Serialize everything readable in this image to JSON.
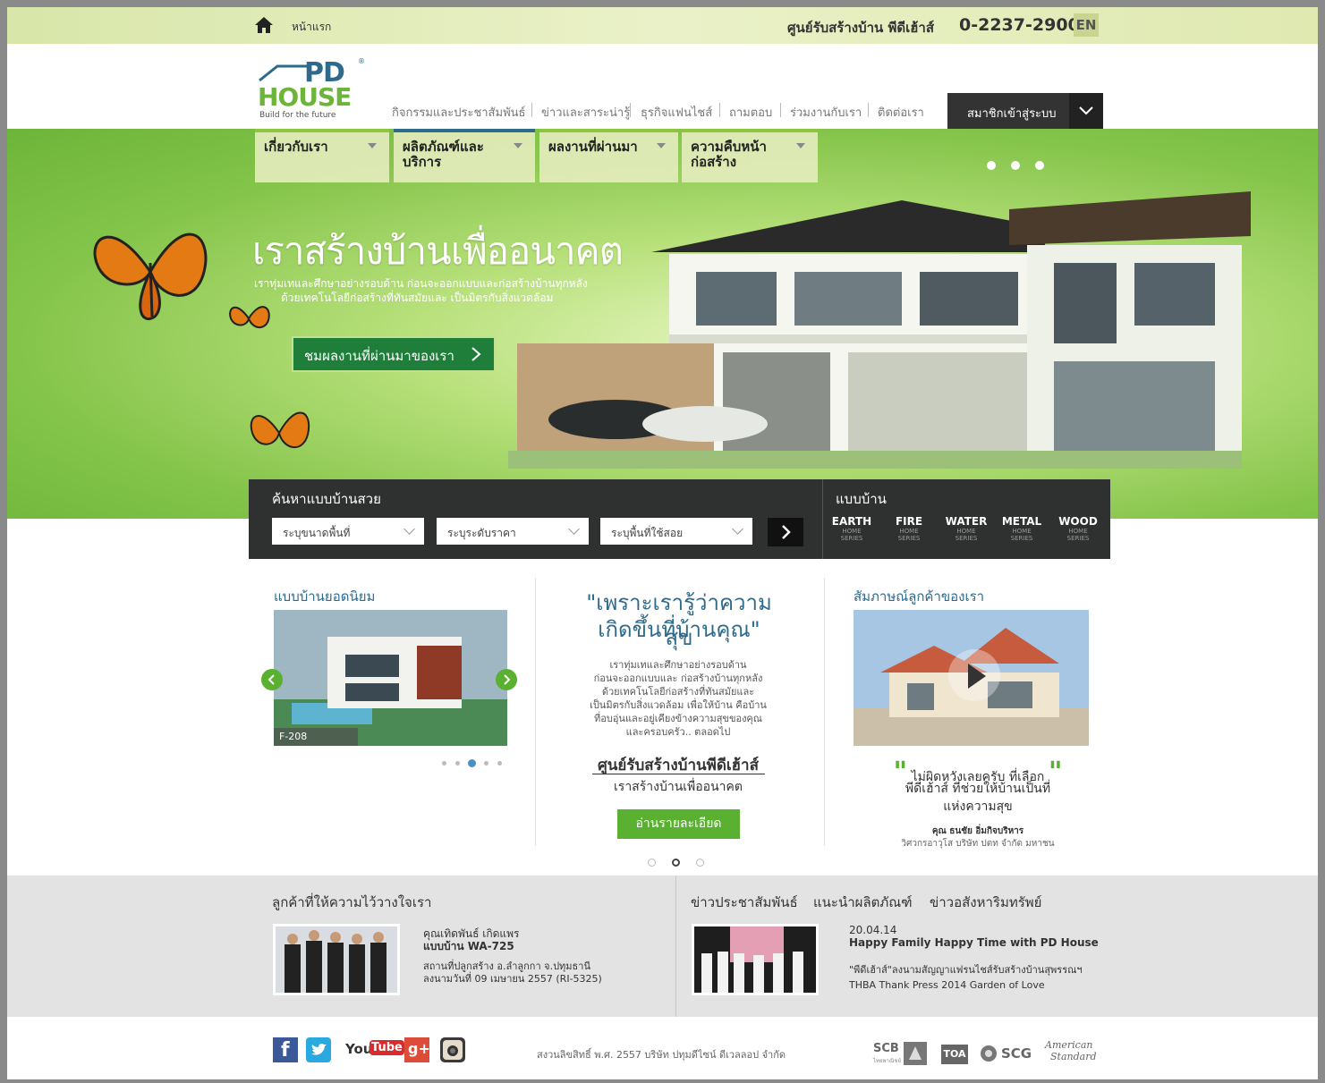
{
  "topbar": {
    "home_label": "หน้าแรก",
    "center_name": "ศูนย์รับสร้างบ้าน พีดีเฮ้าส์",
    "phone": "0-2237-2900",
    "lang": "EN"
  },
  "logo": {
    "brand_top": "PD",
    "brand_bottom": "HOUSE",
    "tagline": "Build for the future",
    "reg": "®"
  },
  "nav": {
    "links": [
      "กิจกรรมและประชาสัมพันธ์",
      "ข่าวและสาระน่ารู้",
      "ธุรกิจแฟนไชส์",
      "ถามตอบ",
      "ร่วมงานกับเรา",
      "ติดต่อเรา"
    ],
    "login_label": "สมาชิกเข้าสู่ระบบ"
  },
  "mainnav": [
    {
      "line1": "เกี่ยวกับเรา",
      "line2": ""
    },
    {
      "line1": "ผลิตภัณฑ์และ",
      "line2": "บริการ"
    },
    {
      "line1": "ผลงานที่ผ่านมา",
      "line2": ""
    },
    {
      "line1": "ความคืบหน้า",
      "line2": "ก่อสร้าง"
    }
  ],
  "hero": {
    "title": "เราสร้างบ้านเพื่ออนาคต",
    "sub1": "เราทุ่มเทและศึกษาอย่างรอบด้าน ก่อนจะออกแบบและก่อสร้างบ้านทุกหลัง",
    "sub2": "ด้วยเทคโนโลยีก่อสร้างที่ทันสมัยและ เป็นมิตรกับสิ่งแวดล้อม",
    "cta": "ชมผลงานที่ผ่านมาของเรา"
  },
  "search": {
    "title": "ค้นหาแบบบ้านสวย",
    "select1": "ระบุขนาดพื้นที่",
    "select2": "ระบุระดับราคา",
    "select3": "ระบุพื้นที่ใช้สอย"
  },
  "types": {
    "title": "แบบบ้าน",
    "items": [
      {
        "name": "EARTH",
        "sub1": "HOME",
        "sub2": "SERIES"
      },
      {
        "name": "FIRE",
        "sub1": "HOME",
        "sub2": "SERIES"
      },
      {
        "name": "WATER",
        "sub1": "HOME",
        "sub2": "SERIES"
      },
      {
        "name": "METAL",
        "sub1": "HOME",
        "sub2": "SERIES"
      },
      {
        "name": "WOOD",
        "sub1": "HOME",
        "sub2": "SERIES"
      }
    ]
  },
  "popular": {
    "title": "แบบบ้านยอดนิยม",
    "caption": "F-208"
  },
  "center": {
    "quote1": "\"เพราะเรารู้ว่าความสุข",
    "quote2": "เกิดขึ้นที่บ้านคุณ\"",
    "lines": [
      "เราทุ่มเทและศึกษาอย่างรอบด้าน",
      "ก่อนจะออกแบบและ ก่อสร้างบ้านทุกหลัง",
      "ด้วยเทคโนโลยีก่อสร้างที่ทันสมัยและ",
      "เป็นมิตรกับสิ่งแวดล้อม เพื่อให้บ้าน คือบ้าน",
      "ที่อบอุ่นและอยู่เคียงข้างความสุขของคุณ",
      "และครอบครัว.. ตลอดไป"
    ],
    "heading": "ศูนย์รับสร้างบ้านพีดีเฮ้าส์",
    "tagline": "เราสร้างบ้านเพื่ออนาคต",
    "readmore": "อ่านรายละเอียด"
  },
  "testimonial": {
    "title": "สัมภาษณ์ลูกค้าของเรา",
    "line1": "ไม่ผิดหวังเลยครับ ที่เลือก",
    "line2": "พีดีเฮ้าส์ ที่ช่วยให้บ้านเป็นที่",
    "line3": "แห่งความสุข",
    "name": "คุณ ธนชัย อิ่มกิจบริหาร",
    "role": "วิศวกรอาวุโส บริษัท ปตท จำกัด มหาชน"
  },
  "customers": {
    "title": "ลูกค้าที่ให้ความไว้วางใจเรา",
    "name": "คุณเทิดพันธ์ เกิดแพร",
    "model": "แบบบ้าน WA-725",
    "location": "สถานที่ปลูกสร้าง อ.ลำลูกกา จ.ปทุมธานี",
    "date": "ลงนามวันที่ 09 เมษายน  2557 (RI-5325)"
  },
  "news": {
    "tabs": [
      "ข่าวประชาสัมพันธ์",
      "แนะนำผลิตภัณฑ์",
      "ข่าวอสังหาริมทรัพย์"
    ],
    "date": "20.04.14",
    "headline": "Happy Family Happy Time with PD House",
    "line1": "\"พีดีเฮ้าส์\"ลงนามสัญญาแฟรนไชส์รับสร้างบ้านสุพรรณฯ",
    "line2": "THBA Thank Press 2014 Garden of Love"
  },
  "footer": {
    "copyright": "สงวนลิขสิทธิ์ พ.ศ. 2557 บริษัท ปทุมดีไซน์ ดีเวลลอป จำกัด",
    "social": {
      "youtube_a": "You",
      "youtube_b": "Tube",
      "gplus": "g+"
    },
    "partners": {
      "scb": "SCB",
      "scb_sub": "ไทยพาณิชย์",
      "toa": "TOA",
      "scg": "SCG",
      "as1": "American",
      "as2": "Standard"
    }
  },
  "colors": {
    "brand_green": "#5ab030",
    "brand_blue": "#2d6a8b",
    "dark": "#2f3131"
  }
}
